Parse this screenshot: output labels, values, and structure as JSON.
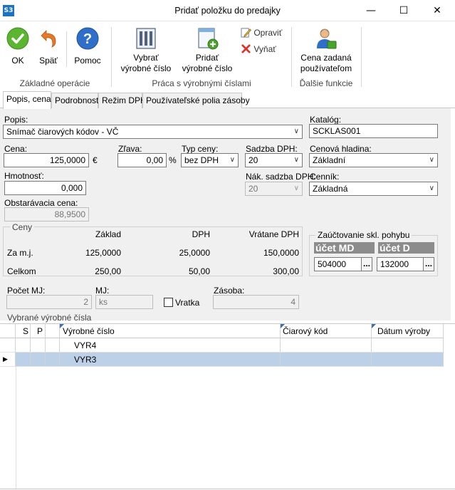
{
  "window": {
    "title": "Pridať položku do predajky",
    "app_icon": "S3",
    "minimize": "—",
    "maximize": "☐",
    "close": "✕"
  },
  "ribbon": {
    "ok": "OK",
    "back": "Späť",
    "help": "Pomoc",
    "group_basic": "Základné operácie",
    "select_serial_l1": "Vybrať",
    "select_serial_l2": "výrobné číslo",
    "add_serial_l1": "Pridať",
    "add_serial_l2": "výrobné číslo",
    "edit": "Opraviť",
    "remove": "Vyňať",
    "group_serials": "Práca s výrobnými číslami",
    "user_price_l1": "Cena zadaná",
    "user_price_l2": "používateľom",
    "group_other": "Ďalšie funkcie"
  },
  "tabs": [
    "Popis, cena",
    "Podrobnosti",
    "Režim DPH",
    "Používateľské polia zásoby"
  ],
  "form": {
    "popis_label": "Popis:",
    "popis_value": "Snímač čiarových kódov - VČ",
    "katalog_label": "Katalóg:",
    "katalog_value": "SCKLAS001",
    "cena_label": "Cena:",
    "cena_value": "125,0000",
    "cena_unit": "€",
    "zlava_label": "Zľava:",
    "zlava_value": "0,00",
    "zlava_unit": "%",
    "typ_ceny_label": "Typ ceny:",
    "typ_ceny_value": "bez DPH",
    "sadzba_label": "Sadzba DPH:",
    "sadzba_value": "20",
    "cenova_hladina_label": "Cenová hladina:",
    "cenova_hladina_value": "Základní",
    "hmotnost_label": "Hmotnosť:",
    "hmotnost_value": "0,000",
    "nak_sadzba_label": "Nák. sadzba DPH:",
    "nak_sadzba_value": "20",
    "cennik_label": "Cenník:",
    "cennik_value": "Základná",
    "obstaravacia_label": "Obstarávacia cena:",
    "obstaravacia_value": "88,9500"
  },
  "ceny": {
    "title": "Ceny",
    "col_zaklad": "Základ",
    "col_dph": "DPH",
    "col_vratane": "Vrátane DPH",
    "row1_label": "Za m.j.",
    "row1": [
      "125,0000",
      "25,0000",
      "150,0000"
    ],
    "row2_label": "Celkom",
    "row2": [
      "250,00",
      "50,00",
      "300,00"
    ]
  },
  "zauctovanie": {
    "title": "Zaúčtovanie skl. pohybu",
    "md_label": "účet MD",
    "md_value": "504000",
    "d_label": "účet D",
    "d_value": "132000",
    "dots": "..."
  },
  "bottom": {
    "pocet_label": "Počet MJ:",
    "pocet_value": "2",
    "mj_label": "MJ:",
    "mj_value": "ks",
    "vratka_label": "Vratka",
    "zasoba_label": "Zásoba:",
    "zasoba_value": "4",
    "vybrane_label": "Vybrané výrobné čísla"
  },
  "grid": {
    "columns": [
      "S",
      "P",
      "Výrobné číslo",
      "Čiarový kód",
      "Dátum výroby"
    ],
    "rows": [
      {
        "serial": "VYR4",
        "barcode": "",
        "date": ""
      },
      {
        "serial": "VYR3",
        "barcode": "",
        "date": ""
      }
    ],
    "selected_row": 1
  },
  "colors": {
    "accent": "#1a73c8",
    "selected_row": "#bcd0e8",
    "form_bg": "#f0f0f0"
  }
}
